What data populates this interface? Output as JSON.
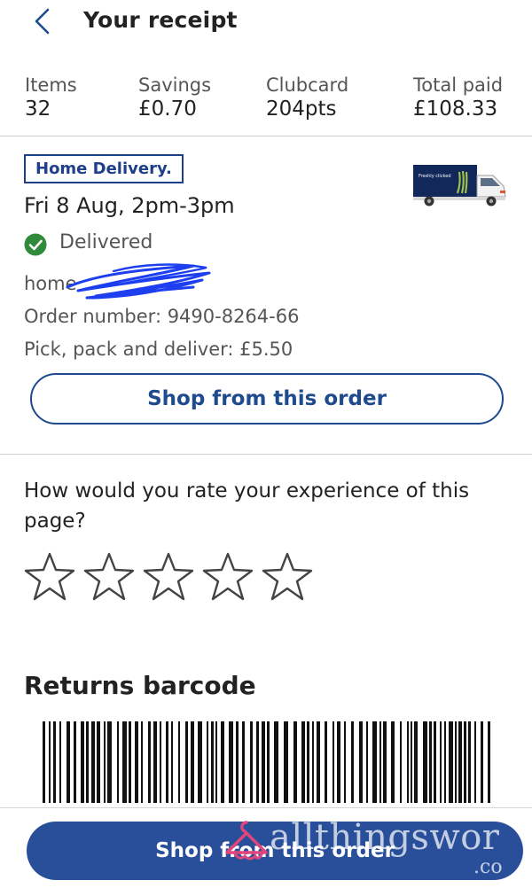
{
  "header": {
    "title": "Your receipt"
  },
  "stats": [
    {
      "label": "Items",
      "value": "32"
    },
    {
      "label": "Savings",
      "value": "£0.70"
    },
    {
      "label": "Clubcard",
      "value": "204pts"
    },
    {
      "label": "Total paid",
      "value": "£108.33"
    }
  ],
  "order": {
    "badge": "Home Delivery.",
    "date": "Fri 8 Aug, 2pm-3pm",
    "status": "Delivered",
    "address_prefix": "home",
    "order_number": "Order number: 9490-8264-66",
    "delivery_charge": "Pick, pack and deliver: £5.50",
    "shop_button": "Shop from this order",
    "van_text": "Freshly clicked"
  },
  "rating": {
    "question": "How would you rate your experience of this page?",
    "stars": 5
  },
  "returns": {
    "title": "Returns barcode"
  },
  "bottom": {
    "button": "Shop from this order"
  },
  "watermark": {
    "text": "allthingswor",
    "sub": ".co"
  },
  "colors": {
    "brand_blue": "#1e4a8e",
    "button_blue": "#2a4f9a",
    "success_green": "#2f8a3a",
    "watermark_pink": "#e0457b"
  }
}
